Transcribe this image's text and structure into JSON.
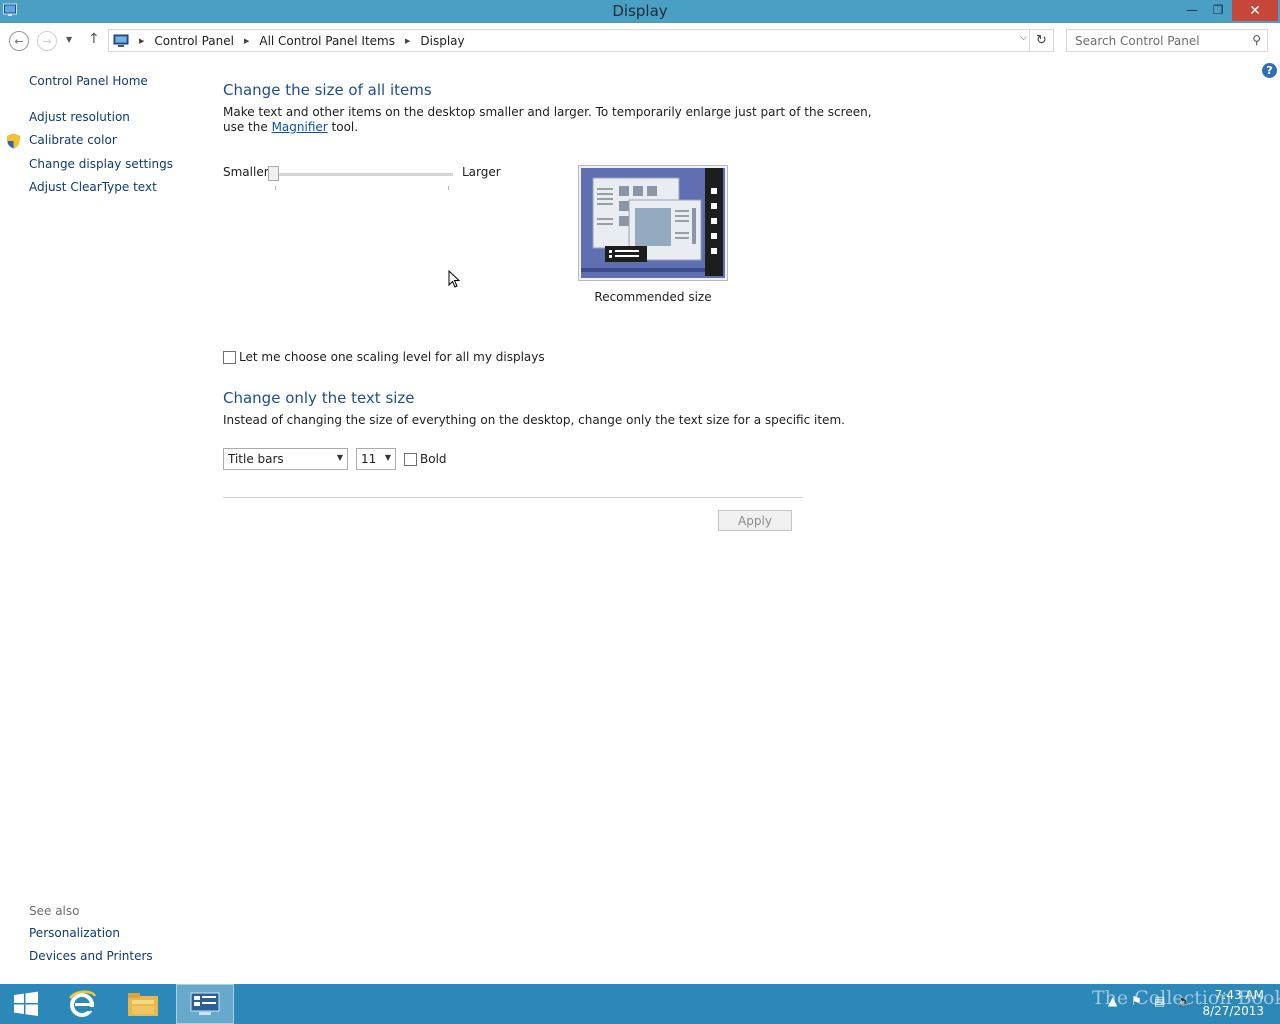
{
  "window": {
    "title": "Display"
  },
  "address": {
    "crumbs": [
      "Control Panel",
      "All Control Panel Items",
      "Display"
    ],
    "search_placeholder": "Search Control Panel"
  },
  "sidebar": {
    "items": [
      {
        "label": "Control Panel Home"
      },
      {
        "label": "Adjust resolution"
      },
      {
        "label": "Calibrate color"
      },
      {
        "label": "Change display settings"
      },
      {
        "label": "Adjust ClearType text"
      }
    ],
    "see_also_label": "See also",
    "see_also": [
      {
        "label": "Personalization"
      },
      {
        "label": "Devices and Printers"
      }
    ]
  },
  "main": {
    "size_heading": "Change the size of all items",
    "size_desc_line1": "Make text and other items on the desktop smaller and larger. To temporarily enlarge just part of the screen,",
    "size_desc_pre": "use the",
    "size_desc_link": "Magnifier",
    "size_desc_post": "tool.",
    "slider_min_label": "Smaller",
    "slider_max_label": "Larger",
    "slider_value_fraction": 0.0,
    "preview_label": "Recommended size",
    "scaling_checkbox_label": "Let me choose one scaling level for all my displays",
    "scaling_checked": false,
    "text_heading": "Change only the text size",
    "text_desc": "Instead of changing the size of everything on the desktop, change only the text size for a specific item.",
    "item_select_value": "Title bars",
    "size_select_value": "11",
    "bold_label": "Bold",
    "bold_checked": false,
    "apply_label": "Apply"
  },
  "taskbar": {
    "time": "7:43 AM",
    "date": "8/27/2013",
    "watermark": "The Collection Book"
  },
  "colors": {
    "titlebar": "#4a9fc4",
    "taskbar": "#2c88b8",
    "heading": "#1e4f8f",
    "link": "#0f3c70",
    "close": "#c7463a"
  }
}
